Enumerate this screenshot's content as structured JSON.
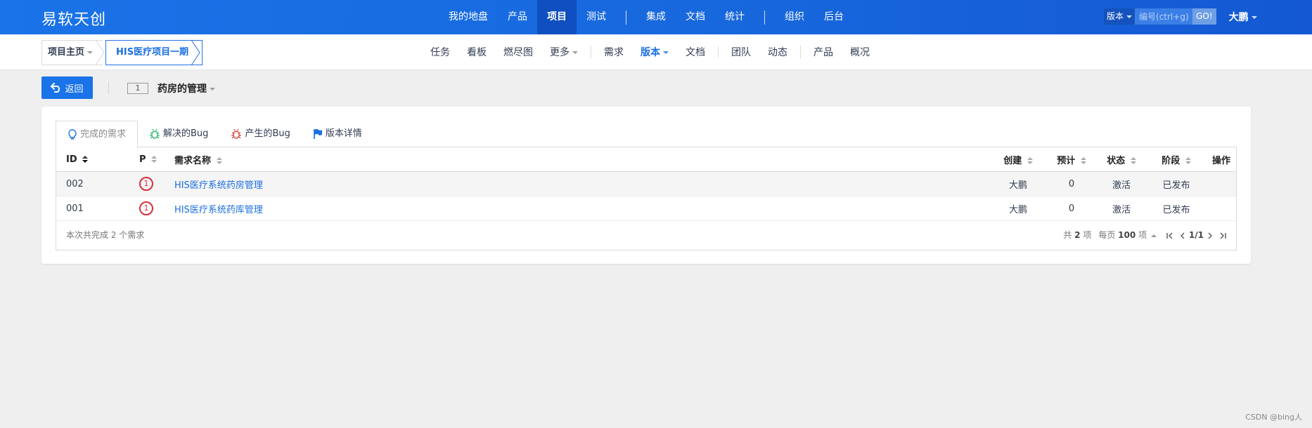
{
  "app": {
    "logo": "易软天创"
  },
  "topnav": {
    "items": [
      "我的地盘",
      "产品",
      "项目",
      "测试",
      "集成",
      "文档",
      "统计",
      "组织",
      "后台"
    ],
    "active": "项目"
  },
  "search": {
    "type": "版本",
    "placeholder": "编号(ctrl+g)",
    "go": "GO!"
  },
  "user": {
    "name": "大鹏"
  },
  "breadcrumb": {
    "home": "项目主页",
    "project": "HIS医疗项目一期"
  },
  "subnav": {
    "items": [
      "任务",
      "看板",
      "燃尽图",
      "更多",
      "需求",
      "版本",
      "文档",
      "团队",
      "动态",
      "产品",
      "概况"
    ],
    "active": "版本"
  },
  "toolbar": {
    "back": "返回",
    "version_no": "1",
    "title": "药房的管理"
  },
  "tabs": [
    "完成的需求",
    "解决的Bug",
    "产生的Bug",
    "版本详情"
  ],
  "table": {
    "headers": {
      "id": "ID",
      "pri": "P",
      "name": "需求名称",
      "creator": "创建",
      "estimate": "预计",
      "status": "状态",
      "stage": "阶段",
      "actions": "操作"
    },
    "rows": [
      {
        "id": "002",
        "pri": "1",
        "name": "HIS医疗系统药房管理",
        "creator": "大鹏",
        "estimate": "0",
        "status": "激活",
        "stage": "已发布"
      },
      {
        "id": "001",
        "pri": "1",
        "name": "HIS医疗系统药库管理",
        "creator": "大鹏",
        "estimate": "0",
        "status": "激活",
        "stage": "已发布"
      }
    ]
  },
  "footer": {
    "summary": "本次共完成 2 个需求",
    "total_prefix": "共",
    "total": "2",
    "total_suffix": "项",
    "per_page_prefix": "每页",
    "per_page": "100",
    "per_page_suffix": "项",
    "page": "1/1"
  },
  "watermark": "CSDN @bing人",
  "colors": {
    "brand": "#1a73e8",
    "priority": "#d9303a",
    "link": "#1b6fe0"
  }
}
